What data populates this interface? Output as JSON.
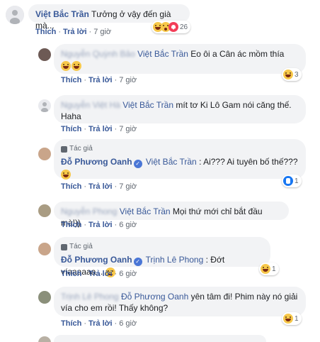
{
  "actions": {
    "like": "Thích",
    "reply": "Trả lời",
    "sep": "·"
  },
  "author_tag": "Tác giả",
  "comments": [
    {
      "name": "Việt Bắc Trần",
      "text": "Tưởng ở vậy đến già mà...",
      "time": "7 giờ",
      "reactions": [
        "haha",
        "like",
        "love"
      ],
      "reaction_count": "26"
    },
    {
      "blurred_name": "Nguyễn Quỳnh Bảo",
      "mention": "Việt Bắc Trần",
      "text": "Eo ôi a Cân ác mồm thía",
      "time": "7 giờ",
      "reactions": [
        "haha"
      ],
      "reaction_count": "3"
    },
    {
      "blurred_name": "Nguyễn Việt Hà",
      "mention": "Việt Bắc Trần",
      "text": "mít tơ Ki Lô Gam nói căng thế. Haha",
      "time": "7 giờ"
    },
    {
      "name": "Đỗ Phương Oanh",
      "verified": true,
      "mention": "Việt Bắc Trần",
      "text": ": Ai??? Ai tuyên bố thế???",
      "time": "7 giờ",
      "reactions": [
        "like"
      ],
      "reaction_count": "1"
    },
    {
      "blurred_name": "Nguyễn Phong",
      "mention": "Việt Bắc Trần",
      "text": "Mọi thứ mới chỉ bắt đầu mà!))",
      "time": "6 giờ"
    },
    {
      "name": "Đỗ Phương Oanh",
      "verified": true,
      "mention": "Trịnh Lê Phong",
      "text": ": Đớt víaaaaaa...",
      "time": "6 giờ",
      "reactions": [
        "haha"
      ],
      "reaction_count": "1"
    },
    {
      "blurred_name": "Trịnh Lê Phong",
      "mention": "Đỗ Phương Oanh",
      "text": "yên tâm đi! Phim này nó giải vía cho em rồi! Thấy không?",
      "time": "6 giờ",
      "reactions": [
        "haha"
      ],
      "reaction_count": "1"
    }
  ]
}
